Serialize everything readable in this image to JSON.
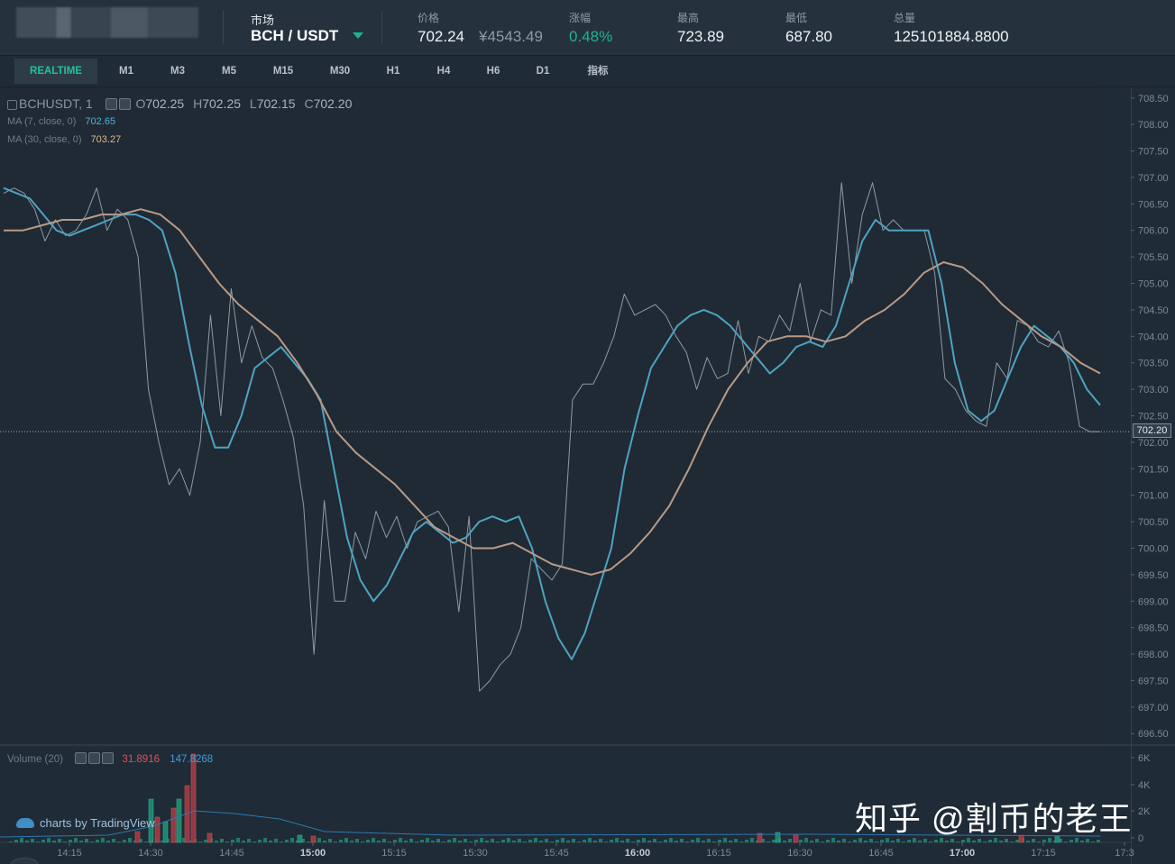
{
  "header": {
    "market_label": "市场",
    "market_pair": "BCH / USDT",
    "stats": [
      {
        "label": "价格",
        "value": "702.24",
        "value2": "¥4543.49"
      },
      {
        "label": "涨幅",
        "value": "0.48%"
      },
      {
        "label": "最高",
        "value": "723.89"
      },
      {
        "label": "最低",
        "value": "687.80"
      },
      {
        "label": "总量",
        "value": "125101884.8800"
      }
    ],
    "colors": {
      "up": "#20b28c"
    }
  },
  "tabs": [
    "REALTIME",
    "M1",
    "M3",
    "M5",
    "M15",
    "M30",
    "H1",
    "H4",
    "H6",
    "D1",
    "指标"
  ],
  "active_tab": "REALTIME",
  "legend": {
    "symbol": "BCHUSDT, 1",
    "o_label": "O",
    "o": "702.25",
    "h_label": "H",
    "h": "702.25",
    "l_label": "L",
    "l": "702.15",
    "c_label": "C",
    "c": "702.20",
    "ma7_label": "MA (7, close, 0)",
    "ma7": "702.65",
    "ma30_label": "MA (30, close, 0)",
    "ma30": "703.27",
    "volume_label": "Volume (20)",
    "vol_a": "31.8916",
    "vol_b": "147.8268",
    "last_price": "702.20"
  },
  "branding": "charts by TradingView",
  "watermark": "知乎 @割币的老王",
  "chart_data": {
    "type": "line",
    "x_ticks": [
      "14:15",
      "14:30",
      "14:45",
      "15:00",
      "15:15",
      "15:30",
      "15:45",
      "16:00",
      "16:15",
      "16:30",
      "16:45",
      "17:00",
      "17:15",
      "17:3"
    ],
    "y_ticks": [
      "708.50",
      "708.00",
      "707.50",
      "707.00",
      "706.50",
      "706.00",
      "705.50",
      "705.00",
      "704.50",
      "704.00",
      "703.50",
      "703.00",
      "702.50",
      "702.00",
      "701.50",
      "701.00",
      "700.50",
      "700.00",
      "699.50",
      "699.00",
      "698.50",
      "698.00",
      "697.50",
      "697.00",
      "696.50"
    ],
    "ylim": [
      696.3,
      708.7
    ],
    "volume_ticks": [
      "6K",
      "4K",
      "2K",
      "0"
    ],
    "series": [
      {
        "name": "price",
        "color": "#8d9aa5",
        "values": [
          706.7,
          706.8,
          706.7,
          706.4,
          705.8,
          706.2,
          705.9,
          706.0,
          706.3,
          706.8,
          706.0,
          706.4,
          706.2,
          705.5,
          703.0,
          702.0,
          701.2,
          701.5,
          701.0,
          702.0,
          704.4,
          702.5,
          704.9,
          703.5,
          704.2,
          703.6,
          703.4,
          702.8,
          702.1,
          700.8,
          698.0,
          700.9,
          699.0,
          699.0,
          700.3,
          699.8,
          700.7,
          700.2,
          700.6,
          700.0,
          700.5,
          700.6,
          700.7,
          700.4,
          698.8,
          700.6,
          697.3,
          697.5,
          697.8,
          698.0,
          698.5,
          699.8,
          699.6,
          699.4,
          699.7,
          702.8,
          703.1,
          703.1,
          703.5,
          704.0,
          704.8,
          704.4,
          704.5,
          704.6,
          704.4,
          704.0,
          703.7,
          703.0,
          703.6,
          703.2,
          703.3,
          704.3,
          703.3,
          704.0,
          703.9,
          704.4,
          704.1,
          705.0,
          703.9,
          704.5,
          704.4,
          706.9,
          705.0,
          706.3,
          706.9,
          706.0,
          706.2,
          706.0,
          706.0,
          706.0,
          705.2,
          703.2,
          703.0,
          702.6,
          702.4,
          702.3,
          703.5,
          703.2,
          704.3,
          704.2,
          703.9,
          703.8,
          704.1,
          703.5,
          702.3,
          702.2,
          702.2
        ]
      },
      {
        "name": "ma7",
        "color": "#4fa3c0",
        "values": [
          706.8,
          706.7,
          706.6,
          706.3,
          706.0,
          705.9,
          706.0,
          706.1,
          706.2,
          706.3,
          706.3,
          706.2,
          706.0,
          705.2,
          703.9,
          702.7,
          701.9,
          701.9,
          702.5,
          703.4,
          703.6,
          703.8,
          703.5,
          703.2,
          702.8,
          701.5,
          700.2,
          699.4,
          699.0,
          699.3,
          699.8,
          700.3,
          700.5,
          700.3,
          700.1,
          700.2,
          700.5,
          700.6,
          700.5,
          700.6,
          700.0,
          699.0,
          698.3,
          697.9,
          698.4,
          699.2,
          700.0,
          701.5,
          702.5,
          703.4,
          703.8,
          704.2,
          704.4,
          704.5,
          704.4,
          704.2,
          703.9,
          703.6,
          703.3,
          703.5,
          703.8,
          703.9,
          703.8,
          704.2,
          705.0,
          705.8,
          706.2,
          706.0,
          706.0,
          706.0,
          706.0,
          705.0,
          703.5,
          702.6,
          702.4,
          702.6,
          703.2,
          703.8,
          704.2,
          704.0,
          703.8,
          703.5,
          703.0,
          702.7
        ]
      },
      {
        "name": "ma30",
        "color": "#b99a85",
        "values": [
          706.0,
          706.0,
          706.1,
          706.2,
          706.2,
          706.3,
          706.3,
          706.4,
          706.3,
          706.0,
          705.5,
          705.0,
          704.6,
          704.3,
          704.0,
          703.5,
          702.9,
          702.2,
          701.8,
          701.5,
          701.2,
          700.8,
          700.4,
          700.2,
          700.0,
          700.0,
          700.1,
          699.9,
          699.7,
          699.6,
          699.5,
          699.6,
          699.9,
          700.3,
          700.8,
          701.5,
          702.3,
          703.0,
          703.5,
          703.9,
          704.0,
          704.0,
          703.9,
          704.0,
          704.3,
          704.5,
          704.8,
          705.2,
          705.4,
          705.3,
          705.0,
          704.6,
          704.3,
          704.0,
          703.8,
          703.5,
          703.3
        ]
      }
    ]
  }
}
